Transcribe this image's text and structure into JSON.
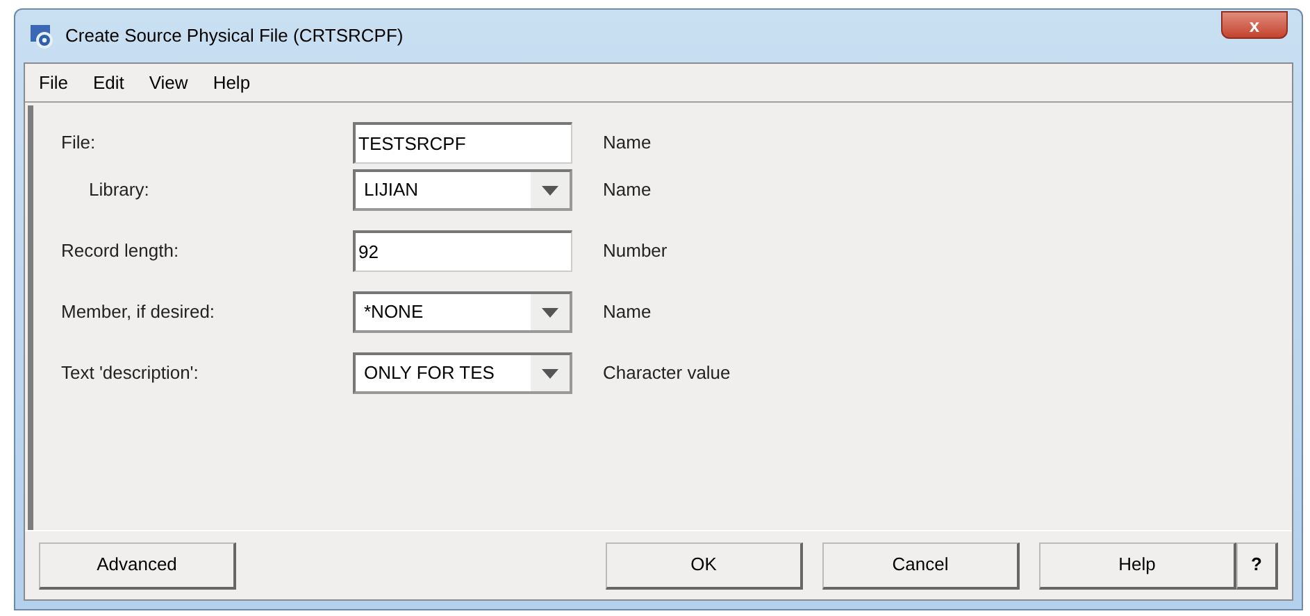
{
  "window": {
    "title": "Create Source Physical File (CRTSRCPF)",
    "close": "x"
  },
  "menu": [
    "File",
    "Edit",
    "View",
    "Help"
  ],
  "fields": [
    {
      "label": "File:",
      "kind": "text",
      "value": "TESTSRCPF",
      "hint": "Name",
      "children": [
        {
          "label": "Library:",
          "kind": "dropdown",
          "value": "LIJIAN",
          "hint": "Name"
        }
      ]
    },
    {
      "label": "Record length:",
      "kind": "text",
      "value": "92",
      "hint": "Number"
    },
    {
      "label": "Member, if desired:",
      "kind": "dropdown",
      "value": "*NONE",
      "hint": "Name"
    },
    {
      "label": "Text 'description':",
      "kind": "dropdown",
      "value": "ONLY FOR TES",
      "hint": "Character value"
    }
  ],
  "buttons_left": [
    "Advanced"
  ],
  "buttons_right": [
    "OK",
    "Cancel",
    "Help",
    "?"
  ]
}
